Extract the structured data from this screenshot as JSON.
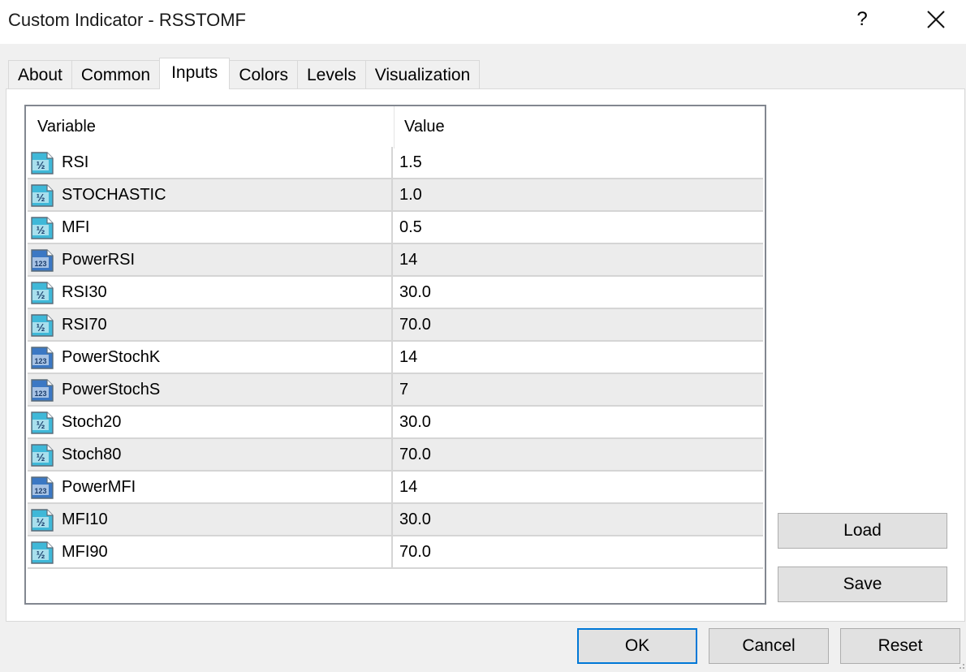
{
  "window": {
    "title": "Custom Indicator - RSSTOMF",
    "help_glyph": "?"
  },
  "tabs": [
    {
      "label": "About"
    },
    {
      "label": "Common"
    },
    {
      "label": "Inputs"
    },
    {
      "label": "Colors"
    },
    {
      "label": "Levels"
    },
    {
      "label": "Visualization"
    }
  ],
  "active_tab": "Inputs",
  "grid": {
    "headers": {
      "variable": "Variable",
      "value": "Value"
    },
    "rows": [
      {
        "icon": "double-type-icon",
        "name": "RSI",
        "value": "1.5"
      },
      {
        "icon": "double-type-icon",
        "name": "STOCHASTIC",
        "value": "1.0"
      },
      {
        "icon": "double-type-icon",
        "name": "MFI",
        "value": "0.5"
      },
      {
        "icon": "integer-type-icon",
        "name": "PowerRSI",
        "value": "14"
      },
      {
        "icon": "double-type-icon",
        "name": "RSI30",
        "value": "30.0"
      },
      {
        "icon": "double-type-icon",
        "name": "RSI70",
        "value": "70.0"
      },
      {
        "icon": "integer-type-icon",
        "name": "PowerStochK",
        "value": "14"
      },
      {
        "icon": "integer-type-icon",
        "name": "PowerStochS",
        "value": "7"
      },
      {
        "icon": "double-type-icon",
        "name": "Stoch20",
        "value": "30.0"
      },
      {
        "icon": "double-type-icon",
        "name": "Stoch80",
        "value": "70.0"
      },
      {
        "icon": "integer-type-icon",
        "name": "PowerMFI",
        "value": "14"
      },
      {
        "icon": "double-type-icon",
        "name": "MFI10",
        "value": "30.0"
      },
      {
        "icon": "double-type-icon",
        "name": "MFI90",
        "value": "70.0"
      }
    ]
  },
  "side_buttons": {
    "load": "Load",
    "save": "Save"
  },
  "footer_buttons": {
    "ok": "OK",
    "cancel": "Cancel",
    "reset": "Reset"
  },
  "colors": {
    "accent": "#0078d7",
    "double_icon": "#3fb8d8",
    "integer_icon": "#3b78c4"
  }
}
